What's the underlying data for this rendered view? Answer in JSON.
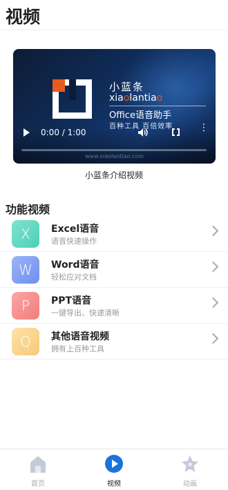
{
  "header": {
    "title": "视频"
  },
  "video": {
    "brand_cn": "小蓝条",
    "brand_en_part1": "xia",
    "brand_en_o": "o",
    "brand_en_part2": "lantia",
    "brand_en_o2": "o",
    "brand_sub": "Office语音助手",
    "brand_sub2": "百种工具 百倍效率",
    "time": "0:00 / 1:00",
    "watermark": "www.xiaolantiao.com",
    "progress": 0,
    "caption": "小蓝条介绍视频"
  },
  "section": {
    "title": "功能视频"
  },
  "items": [
    {
      "title": "Excel语音",
      "subtitle": "语音快速操作",
      "icon_letter": "X",
      "icon": "excel-icon",
      "color_from": "#7ee3cf",
      "color_to": "#4fcfb6"
    },
    {
      "title": "Word语音",
      "subtitle": "轻松应对文档",
      "icon_letter": "W",
      "icon": "word-icon",
      "color_from": "#9bb4f7",
      "color_to": "#6f8ff0"
    },
    {
      "title": "PPT语音",
      "subtitle": "一键导出、快速清晰",
      "icon_letter": "P",
      "icon": "ppt-icon",
      "color_from": "#fba6a6",
      "color_to": "#f27c7c"
    },
    {
      "title": "其他语音视频",
      "subtitle": "拥有上百种工具",
      "icon_letter": "Q",
      "icon": "other-icon",
      "color_from": "#fde2a6",
      "color_to": "#f6c978"
    }
  ],
  "tabs": [
    {
      "label": "首页",
      "icon": "home-icon",
      "active": false
    },
    {
      "label": "视频",
      "icon": "play-circle-icon",
      "active": true
    },
    {
      "label": "动画",
      "icon": "star-icon",
      "active": false
    }
  ],
  "colors": {
    "accent": "#1a73d9",
    "inactive": "#aab4c8"
  }
}
